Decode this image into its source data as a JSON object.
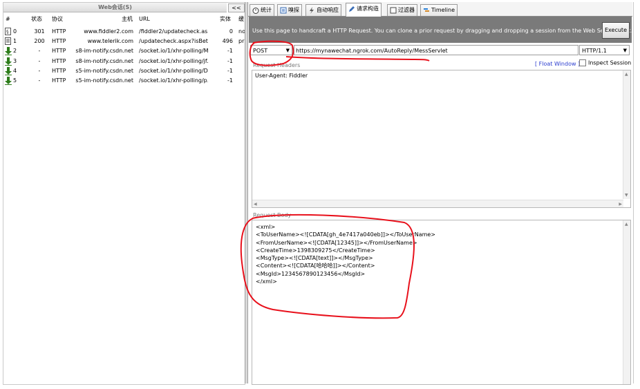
{
  "sessions": {
    "title": "Web会话(S)",
    "collapse_label": "<<",
    "columns": [
      "#",
      "状态",
      "协议",
      "主机",
      "URL",
      "实体",
      "缓"
    ],
    "rows": [
      {
        "num": "0",
        "status": "301",
        "protocol": "HTTP",
        "host": "www.fiddler2.com",
        "url": "/fiddler2/updatecheck.asp...",
        "body": "0",
        "cache": "no",
        "icon": "page-icon"
      },
      {
        "num": "1",
        "status": "200",
        "protocol": "HTTP",
        "host": "www.telerik.com",
        "url": "/updatecheck.aspx?isBeta...",
        "body": "496",
        "cache": "pri",
        "icon": "document-icon"
      },
      {
        "num": "2",
        "status": "-",
        "protocol": "HTTP",
        "host": "s8-im-notify.csdn.net",
        "url": "/socket.io/1/xhr-polling/M...",
        "body": "-1",
        "cache": "",
        "icon": "download-arrow-icon"
      },
      {
        "num": "3",
        "status": "-",
        "protocol": "HTTP",
        "host": "s8-im-notify.csdn.net",
        "url": "/socket.io/1/xhr-polling/jf...",
        "body": "-1",
        "cache": "",
        "icon": "download-arrow-icon"
      },
      {
        "num": "4",
        "status": "-",
        "protocol": "HTTP",
        "host": "s5-im-notify.csdn.net",
        "url": "/socket.io/1/xhr-polling/D...",
        "body": "-1",
        "cache": "",
        "icon": "download-arrow-icon"
      },
      {
        "num": "5",
        "status": "-",
        "protocol": "HTTP",
        "host": "s5-im-notify.csdn.net",
        "url": "/socket.io/1/xhr-polling/p...",
        "body": "-1",
        "cache": "",
        "icon": "download-arrow-icon"
      }
    ]
  },
  "tabs": [
    {
      "label": "统计",
      "icon": "stopwatch-icon"
    },
    {
      "label": "嗅探",
      "icon": "inspect-icon"
    },
    {
      "label": "自动响应",
      "icon": "lightning-icon"
    },
    {
      "label": "请求构造",
      "icon": "pencil-icon"
    },
    {
      "label": "过滤器",
      "icon": "checkbox-icon"
    },
    {
      "label": "Timeline",
      "icon": "timeline-icon"
    }
  ],
  "composer": {
    "banner_text": "Use this page to handcraft a HTTP Request.  You can clone a prior request by dragging and dropping a session from the Web Sessions list.",
    "execute_label": "Execute",
    "method": "POST",
    "url": "https://mynawechat.ngrok.com/AutoReply/MessServlet",
    "http_version": "HTTP/1.1",
    "request_headers_label": "Request Headers",
    "float_window_label": "[ Float Window ]",
    "inspect_session_label": "Inspect Session",
    "headers_text": "User-Agent: Fiddler",
    "request_body_label": "Request Body",
    "body_text": "<xml>\n<ToUserName><![CDATA[gh_4e7417a040eb]]></ToUserName>\n<FromUserName><![CDATA[12345]]></FromUserName>\n<CreateTime>1398309275</CreateTime>\n<MsgType><![CDATA[text]]></MsgType>\n<Content><![CDATA[哈哈哈]]></Content>\n<MsgId>1234567890123456</MsgId>\n</xml>"
  },
  "colors": {
    "annotation": "#e8101b",
    "banner_bg": "#7a7a7a",
    "link": "#2a3ccf",
    "download_arrow": "#2f7d1c"
  }
}
